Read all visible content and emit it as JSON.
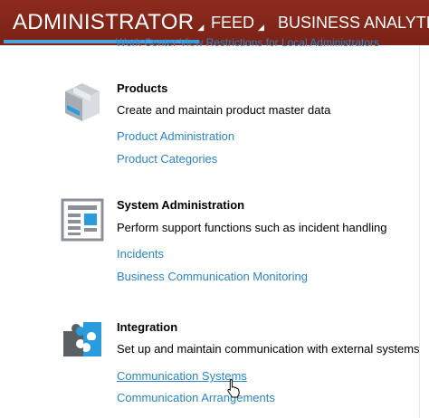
{
  "nav": {
    "tabs": [
      {
        "label": "ADMINISTRATOR"
      },
      {
        "label": "FEED"
      },
      {
        "label": "BUSINESS ANALYTIC"
      }
    ],
    "partial_text": "Work Center View Restrictions for Local Administrators"
  },
  "sections": [
    {
      "title": "Products",
      "description": "Create and maintain product master data",
      "icon": "product-box-icon",
      "links": [
        "Product Administration",
        "Product Categories"
      ]
    },
    {
      "title": "System Administration",
      "description": "Perform support functions such as incident handling",
      "icon": "system-admin-icon",
      "links": [
        "Incidents",
        "Business Communication Monitoring"
      ]
    },
    {
      "title": "Integration",
      "description": "Set up and maintain communication with external systems",
      "icon": "puzzle-icon",
      "links": [
        "Communication Systems",
        "Communication Arrangements"
      ]
    }
  ],
  "colors": {
    "nav_bg": "#7a2216",
    "link": "#2a86c4",
    "active_underline": "#4aa3df"
  }
}
